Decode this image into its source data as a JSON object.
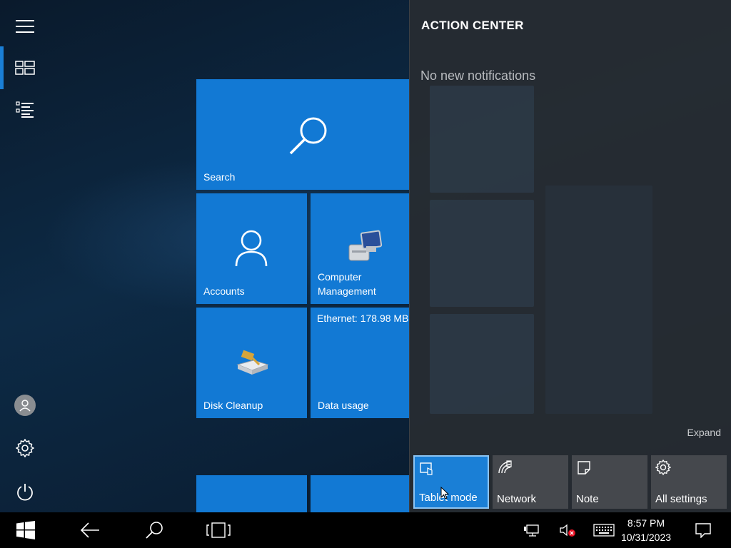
{
  "start": {
    "tiles": {
      "search": "Search",
      "accounts": "Accounts",
      "computer_management": "Computer Management",
      "ethernet_usage": "Ethernet: 178.98 MB",
      "disk_cleanup": "Disk Cleanup",
      "data_usage": "Data usage"
    },
    "rail_icons": [
      "hamburger-menu-icon",
      "tiles-view-icon",
      "all-apps-list-icon",
      "user-avatar-icon",
      "gear-icon",
      "power-icon"
    ]
  },
  "action_center": {
    "title": "ACTION CENTER",
    "empty_message": "No new notifications",
    "expand_label": "Expand",
    "quick_actions": [
      {
        "label": "Tablet mode",
        "icon": "tablet-mode-icon",
        "active": true
      },
      {
        "label": "Network",
        "icon": "network-icon",
        "active": false
      },
      {
        "label": "Note",
        "icon": "note-icon",
        "active": false
      },
      {
        "label": "All settings",
        "icon": "gear-icon",
        "active": false
      }
    ]
  },
  "taskbar": {
    "time": "8:57 PM",
    "date": "10/31/2023",
    "icons": [
      "windows-start-icon",
      "back-arrow-icon",
      "search-icon",
      "task-view-icon",
      "network-monitor-icon",
      "volume-muted-icon",
      "touch-keyboard-icon",
      "action-center-icon"
    ]
  },
  "colors": {
    "tile_blue": "#1279d4",
    "accent": "#1a7fd6",
    "action_center_bg": "#2c3036",
    "quick_action_bg": "#45484d"
  }
}
